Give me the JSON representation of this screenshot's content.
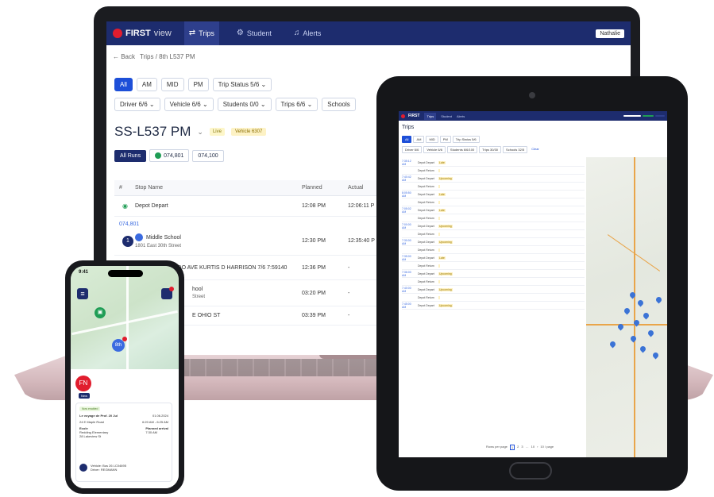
{
  "laptop": {
    "brand": "FIRST",
    "brand_suffix": "view",
    "nav": [
      {
        "icon": "route-icon",
        "label": "Trips"
      },
      {
        "icon": "student-icon",
        "label": "Student"
      },
      {
        "icon": "bell-icon",
        "label": "Alerts"
      }
    ],
    "user_chip": "Nathalie",
    "breadcrumb": {
      "back": "← Back",
      "path": "Trips / 8th L537 PM"
    },
    "period_filters": [
      "All",
      "AM",
      "MID",
      "PM"
    ],
    "trip_status_filter": "Trip Status  5/6 ⌄",
    "filters": [
      "Driver  6/6 ⌄",
      "Vehicle  6/6 ⌄",
      "Students  0/0 ⌄",
      "Trips  6/6 ⌄",
      "Schools"
    ],
    "route_title": "SS-L537 PM",
    "live_badge": "Live",
    "vehicle_badge": "Vehicle 6307",
    "route_tabs": [
      "All Runs",
      "074,801",
      "074,100"
    ],
    "table": {
      "headers": [
        "#",
        "Stop Name",
        "Planned",
        "Actual"
      ],
      "depot": {
        "name": "Depot Depart",
        "planned": "12:08 PM",
        "actual": "12:06:11 P"
      },
      "trip_id": "074,801",
      "stops": [
        {
          "num": "1",
          "name": "Middle School",
          "sub": "1801 East 30th Street",
          "planned": "12:30 PM",
          "actual": "12:35:40 P"
        },
        {
          "num": "2",
          "name": "4011 N COLORADO AVE KURTIS D HARRISON 7/6 7:59140",
          "sub": "",
          "planned": "12:36 PM",
          "actual": "-"
        },
        {
          "num": "",
          "name": "hool",
          "sub": "Street",
          "planned": "03:20 PM",
          "actual": "-"
        },
        {
          "num": "",
          "name": "E OHIO ST",
          "sub": "",
          "planned": "03:39 PM",
          "actual": "-"
        }
      ]
    }
  },
  "tablet": {
    "brand": "FIRST",
    "nav": [
      "Trips",
      "Student",
      "Alerts"
    ],
    "page_title": "Trips",
    "pills": [
      "All",
      "AM",
      "MID",
      "PM",
      "Trip Status 5/6"
    ],
    "pills2": [
      "Driver 6/6",
      "Vehicle 6/6",
      "Students 6/6/100",
      "Trips 30/30",
      "Schools 32/5",
      "Clear"
    ],
    "rows": [
      {
        "time": "7:35:12 AM",
        "name": "Depot Depart",
        "tag": "Late"
      },
      {
        "time": "",
        "name": "Depot Return",
        "tag": ""
      },
      {
        "time": "7:40:42 AM",
        "name": "Depot Depart",
        "tag": "Upcoming"
      },
      {
        "time": "",
        "name": "Depot Return",
        "tag": ""
      },
      {
        "time": "8:05:50 AM",
        "name": "Depot Depart",
        "tag": "Late"
      },
      {
        "time": "",
        "name": "Depot Return",
        "tag": ""
      },
      {
        "time": "7:05:02 AM",
        "name": "Depot Depart",
        "tag": "Late"
      },
      {
        "time": "",
        "name": "Depot Return",
        "tag": ""
      },
      {
        "time": "7:00:00 AM",
        "name": "Depot Depart",
        "tag": "Upcoming"
      },
      {
        "time": "",
        "name": "Depot Return",
        "tag": ""
      },
      {
        "time": "7:30:00 AM",
        "name": "Depot Depart",
        "tag": "Upcoming"
      },
      {
        "time": "",
        "name": "Depot Return",
        "tag": ""
      },
      {
        "time": "7:35:00 AM",
        "name": "Depot Depart",
        "tag": "Late"
      },
      {
        "time": "",
        "name": "Depot Return",
        "tag": ""
      },
      {
        "time": "7:36:00 AM",
        "name": "Depot Depart",
        "tag": "Upcoming"
      },
      {
        "time": "",
        "name": "Depot Return",
        "tag": ""
      },
      {
        "time": "7:40:00 AM",
        "name": "Depot Depart",
        "tag": "Upcoming"
      },
      {
        "time": "",
        "name": "Depot Return",
        "tag": ""
      },
      {
        "time": "7:45:00 AM",
        "name": "Depot Depart",
        "tag": "Upcoming"
      }
    ],
    "pager": [
      "Rows per page",
      "1",
      "2",
      "3",
      "…",
      "10",
      "›",
      "10 / page"
    ]
  },
  "phone": {
    "status_time": "9:41",
    "bus_icon": "bus-icon",
    "stop_label": "8th",
    "avatar": "FN",
    "avatar_tag": "New",
    "card": {
      "status_tag": "Now enabled",
      "title": "Le voyage de Prof. 20 Jul",
      "date": "01.06.2024",
      "stop_a": "24 E Maple Road",
      "time_a": "6:20 AM - 6:25 AM",
      "school_label": "Ecole",
      "school_name": "Redding Elementary",
      "school_addr": "28 Lakeview St",
      "arrival_label": "Planned arrival",
      "arrival_time": "7:30 AM",
      "vehicle": "Vehicle: Bus 26 LC04695",
      "driver": "Driver: REGMANN"
    }
  },
  "colors": {
    "nav_blue": "#1d2c6e",
    "accent_blue": "#1d4fd8",
    "brand_red": "#e11d2e",
    "green": "#1f9d55"
  }
}
